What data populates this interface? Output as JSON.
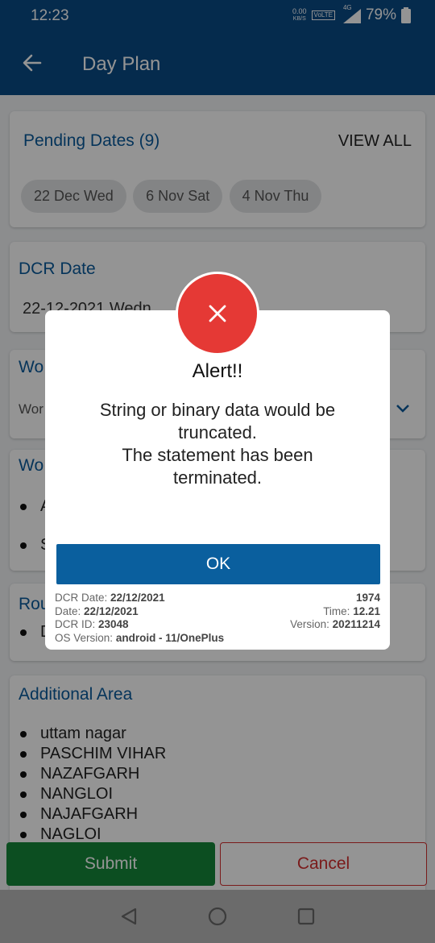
{
  "status_bar": {
    "time": "12:23",
    "net_speed_value": "0.00",
    "net_speed_unit": "KB/S",
    "volte": "VoLTE",
    "network": "4G",
    "battery": "79%"
  },
  "app_bar": {
    "title": "Day Plan"
  },
  "pending": {
    "title": "Pending Dates (9)",
    "view_all": "VIEW ALL",
    "chips": [
      "22 Dec Wed",
      "6 Nov Sat",
      "4 Nov Thu"
    ]
  },
  "dcr_date": {
    "label": "DCR Date",
    "value": "22-12-2021 Wedn"
  },
  "work_type": {
    "label": "Wo",
    "value": "Wor"
  },
  "work_with": {
    "label": "Wo",
    "items": [
      "A",
      "S"
    ]
  },
  "route": {
    "label": "Rou",
    "items": [
      "D"
    ]
  },
  "additional_area": {
    "label": "Additional Area",
    "items": [
      "uttam nagar",
      "PASCHIM VIHAR",
      "NAZAFGARH",
      "NANGLOI",
      "NAJAFGARH",
      "NAGLOI"
    ]
  },
  "footer": {
    "submit": "Submit",
    "cancel": "Cancel"
  },
  "dialog": {
    "icon": "close-icon",
    "title": "Alert!!",
    "message_line1": "String or binary data would be",
    "message_line2": "truncated.",
    "message_line3": "The statement has been",
    "message_line4": "terminated.",
    "ok": "OK",
    "dcr_date_label": "DCR Date:",
    "dcr_date_value": "22/12/2021",
    "date_label": "Date:",
    "date_value": "22/12/2021",
    "dcr_id_label": "DCR ID:",
    "dcr_id_value": "23048",
    "os_label": "OS Version:",
    "os_value": "android - 11/OnePlus",
    "code": "1974",
    "time_label": "Time:",
    "time_value": "12.21",
    "version_label": "Version:",
    "version_value": "20211214"
  },
  "colors": {
    "primary": "#0a4a85",
    "accent_blue": "#0a5a9c",
    "alert_red": "#e53935",
    "submit_green": "#16873a",
    "cancel_red": "#d32f2f"
  }
}
